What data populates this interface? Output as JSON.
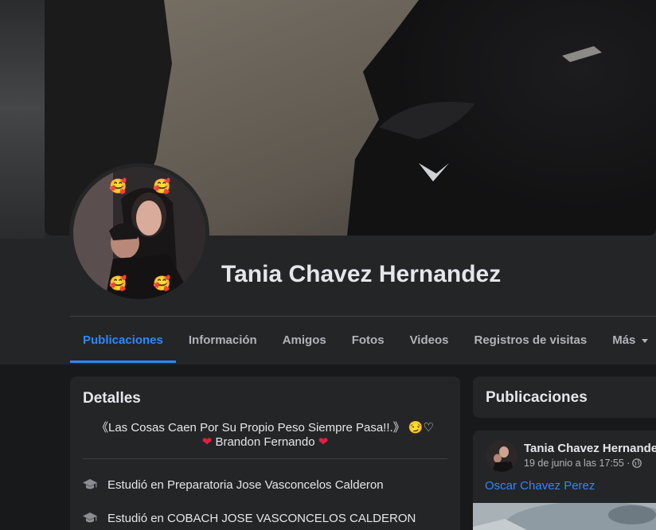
{
  "profile": {
    "name": "Tania Chavez Hernandez"
  },
  "tabs": [
    {
      "label": "Publicaciones"
    },
    {
      "label": "Información"
    },
    {
      "label": "Amigos"
    },
    {
      "label": "Fotos"
    },
    {
      "label": "Videos"
    },
    {
      "label": "Registros de visitas"
    },
    {
      "label": "Más"
    }
  ],
  "details": {
    "title": "Detalles",
    "bio_line1": "《Las Cosas Caen Por Su Propio Peso Siempre Pasa!!.》 😏♡",
    "bio_line2_heart_left": "❤",
    "bio_line2_name": "Brandon Fernando",
    "bio_line2_heart_right": "❤",
    "items": [
      {
        "text": "Estudió en Preparatoria Jose Vasconcelos Calderon",
        "icon": "graduation-cap-icon"
      },
      {
        "text": "Estudió en COBACH JOSE VASCONCELOS CALDERON",
        "icon": "graduation-cap-icon"
      }
    ]
  },
  "publications": {
    "title": "Publicaciones"
  },
  "post": {
    "author": "Tania Chavez Hernandez",
    "date": "19 de junio a las 17:55 ·",
    "tagged": "Oscar Chavez Perez",
    "privacy_icon": "globe-icon"
  },
  "colors": {
    "accent": "#2d88ff",
    "surface": "#242526",
    "background": "#18191a",
    "text_primary": "#e4e6eb",
    "text_secondary": "#b0b3b8",
    "heart": "#e41e3f"
  }
}
